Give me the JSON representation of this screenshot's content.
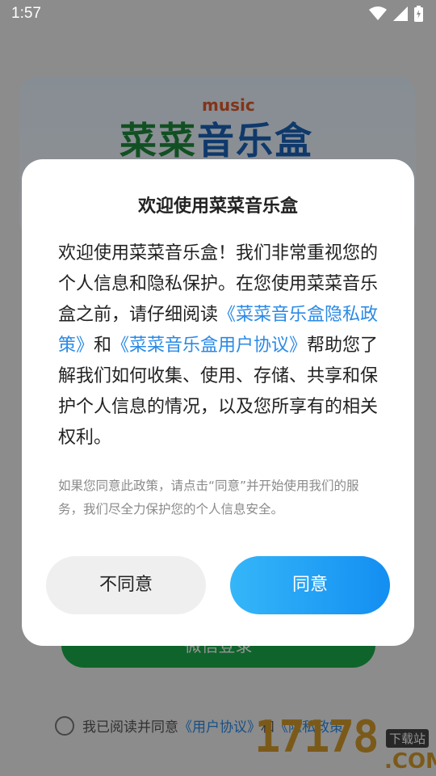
{
  "status_bar": {
    "time": "1:57"
  },
  "background": {
    "logo_music": "music",
    "logo_title_part1": "菜菜",
    "logo_title_part2": "音乐盒",
    "wechat_button": "微信登录",
    "agree_prefix": "我已阅读并同意",
    "agree_link1": "《用户协议》",
    "agree_mid": "和",
    "agree_link2": "《隐私政策》",
    "watermark": "17178",
    "watermark_sub": "下载站",
    "watermark_com": ".COM"
  },
  "dialog": {
    "title": "欢迎使用菜菜音乐盒",
    "body_part1": "欢迎使用菜菜音乐盒！我们非常重视您的个人信息和隐私保护。在您使用菜菜音乐盒之前，请仔细阅读",
    "privacy_link": "《菜菜音乐盒隐私政策》",
    "body_and": "和",
    "agreement_link": "《菜菜音乐盒用户协议》",
    "body_part2": "帮助您了解我们如何收集、使用、存储、共享和保护个人信息的情况，以及您所享有的相关权利。",
    "note": "如果您同意此政策，请点击“同意”并开始使用我们的服务，我们尽全力保护您的个人信息安全。",
    "decline_label": "不同意",
    "accept_label": "同意"
  }
}
